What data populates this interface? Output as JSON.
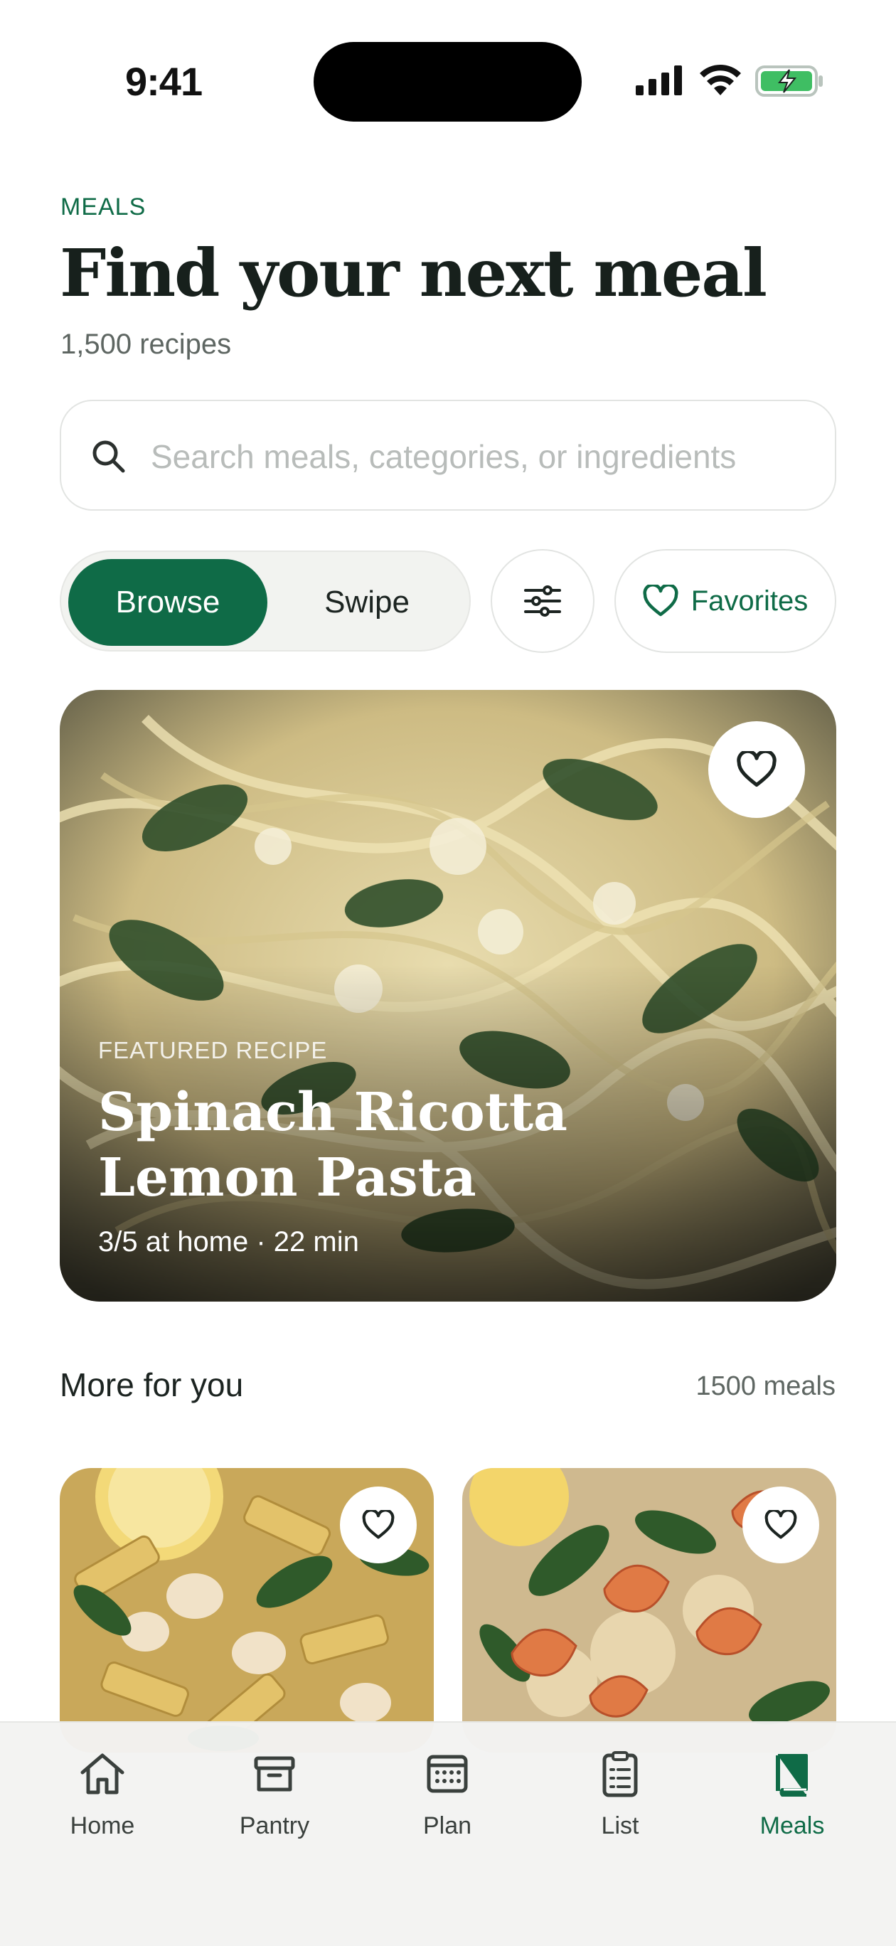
{
  "status_bar": {
    "time": "9:41"
  },
  "header": {
    "eyebrow": "MEALS",
    "title": "Find your next meal",
    "subtitle": "1,500 recipes"
  },
  "search": {
    "placeholder": "Search meals, categories, or ingredients",
    "value": ""
  },
  "mode_toggle": {
    "browse_label": "Browse",
    "swipe_label": "Swipe",
    "selected": "Browse"
  },
  "favorites_button": {
    "label": "Favorites"
  },
  "featured": {
    "eyebrow": "FEATURED RECIPE",
    "title": "Spinach Ricotta Lemon Pasta",
    "meta": "3/5 at home · 22 min",
    "image": "spinach-ricotta-pasta"
  },
  "more_for_you": {
    "title": "More for you",
    "count": "1500 meals",
    "cards": [
      {
        "image": "lemon-penne-beans-spinach"
      },
      {
        "image": "shrimp-quinoa-spinach"
      }
    ]
  },
  "tab_bar": {
    "tabs": [
      {
        "label": "Home",
        "icon": "home-icon"
      },
      {
        "label": "Pantry",
        "icon": "pantry-box-icon"
      },
      {
        "label": "Plan",
        "icon": "calendar-icon"
      },
      {
        "label": "List",
        "icon": "clipboard-list-icon"
      },
      {
        "label": "Meals",
        "icon": "recipe-book-icon"
      }
    ],
    "active": "Meals"
  },
  "colors": {
    "accent": "#0f6b47",
    "text": "#1c2421",
    "muted": "#5e6662",
    "segment_bg": "#f2f3f0"
  }
}
